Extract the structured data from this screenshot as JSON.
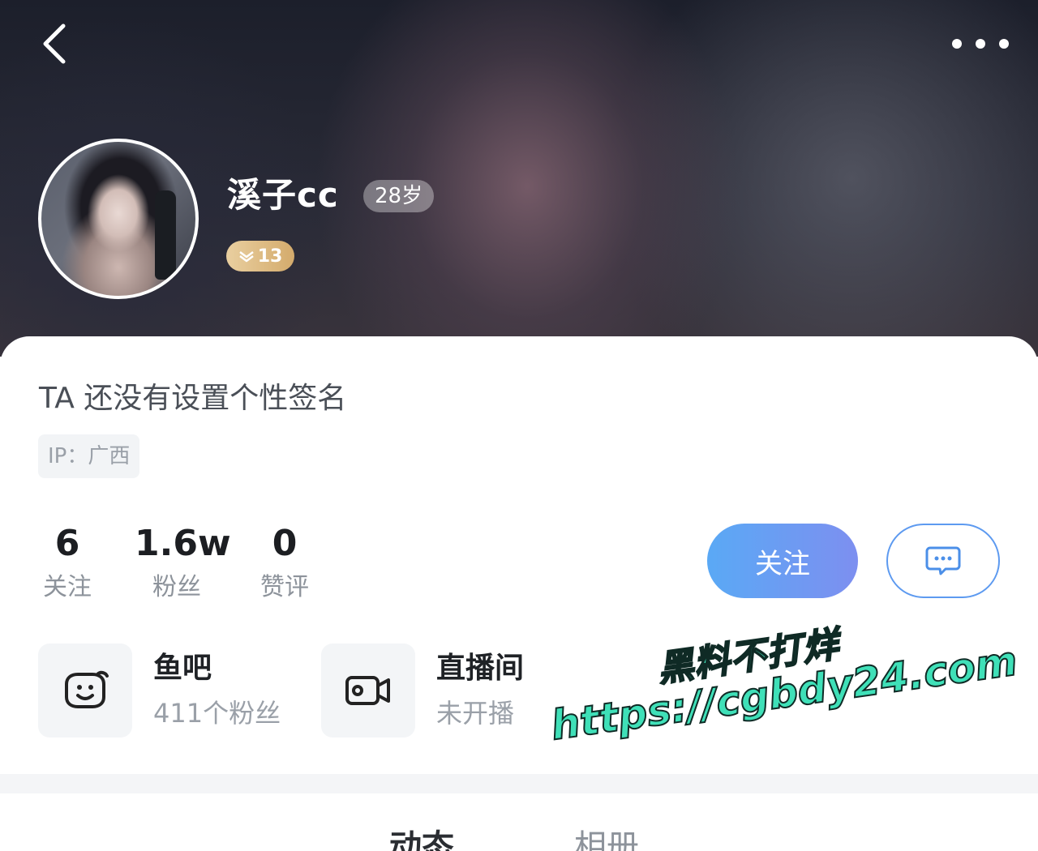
{
  "header": {
    "back_icon": "chevron-left-icon",
    "more_icon": "more-horizontal-icon"
  },
  "profile": {
    "username": "溪子cc",
    "age": "28岁",
    "level": "13",
    "signature": "TA 还没有设置个性签名",
    "ip": "IP：广西"
  },
  "stats": [
    {
      "value": "6",
      "label": "关注"
    },
    {
      "value": "1.6w",
      "label": "粉丝"
    },
    {
      "value": "0",
      "label": "赞评"
    }
  ],
  "actions": {
    "follow_label": "关注",
    "message_icon": "chat-bubble-icon",
    "accent_color": "#5aa9f5"
  },
  "entries": [
    {
      "title": "鱼吧",
      "subtitle": "411个粉丝",
      "icon": "fish-bar-icon"
    },
    {
      "title": "直播间",
      "subtitle": "未开播",
      "icon": "video-camera-icon"
    }
  ],
  "tabs": [
    {
      "label": "动态"
    },
    {
      "label": "相册"
    }
  ],
  "watermark": {
    "line1": "黑料不打烊",
    "line2": "https://cgbdy24.com"
  }
}
